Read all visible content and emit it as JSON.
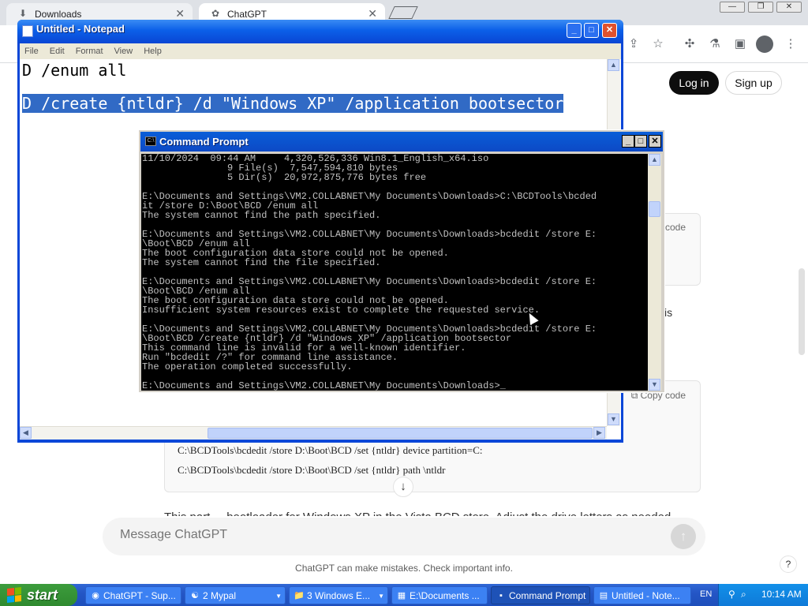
{
  "browser": {
    "tabs": [
      {
        "label": "Downloads",
        "icon": "download-icon"
      },
      {
        "label": "ChatGPT",
        "icon": "chatgpt-icon"
      }
    ],
    "close_glyph": "✕"
  },
  "chatgpt": {
    "login_label": "Log in",
    "signup_label": "Sign up",
    "copy_code_label": "code",
    "copy_code_label_2": "Copy code",
    "code_lines": [
      "C:\\BCDTools\\bcdedit /store D:\\Boot\\BCD /set {ntldr} device partition=C:",
      "C:\\BCDTools\\bcdedit /store D:\\Boot\\BCD /set {ntldr} path \\ntldr"
    ],
    "fragment_text": "is",
    "peek_text": "This part ... bootloader for Windows XP in the Vista BCD store. Adjust the drive letters as needed.",
    "message_placeholder": "Message ChatGPT",
    "disclaimer": "ChatGPT can make mistakes. Check important info.",
    "help_label": "?"
  },
  "notepad": {
    "title": "Untitled - Notepad",
    "menu": [
      "File",
      "Edit",
      "Format",
      "View",
      "Help"
    ],
    "lines": [
      "D /enum all",
      "D /create {ntldr} /d \"Windows XP\" /application bootsector"
    ]
  },
  "cmd": {
    "title": "Command Prompt",
    "icon_label": "C:\\",
    "lines": [
      "11/10/2024  09:44 AM     4,320,526,336 Win8.1_English_x64.iso",
      "               9 File(s)  7,547,594,810 bytes",
      "               5 Dir(s)  20,972,875,776 bytes free",
      "",
      "E:\\Documents and Settings\\VM2.COLLABNET\\My Documents\\Downloads>C:\\BCDTools\\bcded",
      "it /store D:\\Boot\\BCD /enum all",
      "The system cannot find the path specified.",
      "",
      "E:\\Documents and Settings\\VM2.COLLABNET\\My Documents\\Downloads>bcdedit /store E:",
      "\\Boot\\BCD /enum all",
      "The boot configuration data store could not be opened.",
      "The system cannot find the file specified.",
      "",
      "E:\\Documents and Settings\\VM2.COLLABNET\\My Documents\\Downloads>bcdedit /store E:",
      "\\Boot\\BCD /enum all",
      "The boot configuration data store could not be opened.",
      "Insufficient system resources exist to complete the requested service.",
      "",
      "E:\\Documents and Settings\\VM2.COLLABNET\\My Documents\\Downloads>bcdedit /store E:",
      "\\Boot\\BCD /create {ntldr} /d \"Windows XP\" /application bootsector",
      "This command line is invalid for a well-known identifier.",
      "Run \"bcdedit /?\" for command line assistance.",
      "The operation completed successfully.",
      "",
      "E:\\Documents and Settings\\VM2.COLLABNET\\My Documents\\Downloads>_"
    ]
  },
  "taskbar": {
    "start_label": "start",
    "items": [
      {
        "label": "ChatGPT - Sup...",
        "icon": "chrome-icon"
      },
      {
        "label": "2 Mypal",
        "icon": "mypal-icon"
      },
      {
        "label": "3 Windows E...",
        "icon": "folder-icon"
      },
      {
        "label": "E:\\Documents ...",
        "icon": "7zip-icon"
      },
      {
        "label": "Command Prompt",
        "icon": "cmd-icon"
      },
      {
        "label": "Untitled - Note...",
        "icon": "notepad-icon"
      }
    ],
    "language": "EN",
    "clock": "10:14 AM"
  },
  "colors": {
    "xp_blue": "#0a47d8",
    "selection": "#316ac5",
    "taskbar": "#2456c6",
    "start_green": "#3c9c3c"
  }
}
